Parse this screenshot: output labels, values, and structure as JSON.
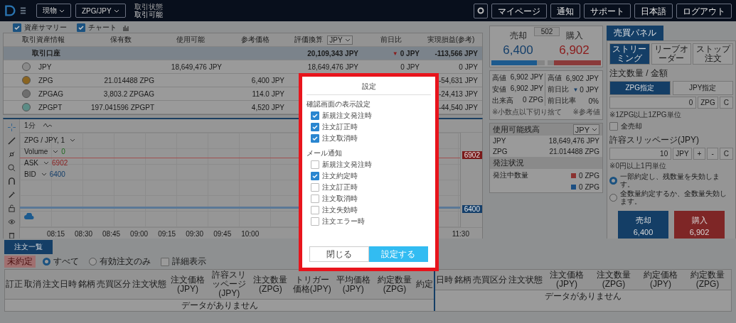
{
  "header": {
    "menu": "現物",
    "pair": "ZPG/JPY",
    "status_label": "取引状態",
    "status": "取引可能",
    "buttons": [
      "マイページ",
      "通知",
      "サポート",
      "日本語",
      "ログアウト"
    ]
  },
  "view_toggles": [
    {
      "label": "資産サマリー",
      "checked": true
    },
    {
      "label": "チャート",
      "checked": true
    }
  ],
  "assets": {
    "columns": [
      "取引資産情報",
      "保有数",
      "使用可能",
      "参考価格",
      "評価換算",
      "前日比",
      "実現損益(参考)"
    ],
    "currency_select": "JPY",
    "rows": [
      {
        "kind": "total",
        "name": "取引口座",
        "value": "20,109,343 JPY",
        "change_mark": "▼",
        "change": "0 JPY",
        "pnl": "-113,566 JPY"
      },
      {
        "kind": "asset",
        "name": "JPY",
        "color": "#8a8a8a",
        "usable": "18,649,476 JPY",
        "value": "18,649,476 JPY",
        "change": "0 JPY",
        "pnl": "0 JPY"
      },
      {
        "kind": "asset",
        "name": "ZPG",
        "color": "#8a6420",
        "held": "21.014488 ZPG",
        "price": "6,400 JPY",
        "pnl": "-54,631 JPY"
      },
      {
        "kind": "asset",
        "name": "ZPGAG",
        "color": "#6e6e6e",
        "held": "3,803.2 ZPGAG",
        "price": "114.0 JPY",
        "pnl": "-24,413 JPY"
      },
      {
        "kind": "asset",
        "name": "ZPGPT",
        "color": "#5c8c86",
        "held": "197.041596 ZPGPT",
        "price": "4,520 JPY",
        "pnl": "-44,540 JPY"
      }
    ]
  },
  "chart": {
    "interval": "1分",
    "symbol": "ZPG / JPY, 1",
    "volume_label": "Volume",
    "volume": "0",
    "ask_label": "ASK",
    "ask": "6902",
    "bid_label": "BID",
    "bid": "6400",
    "ask_tag": "6902",
    "bid_tag": "6400",
    "times": [
      "08:15",
      "08:30",
      "08:45",
      "09:00",
      "09:15",
      "09:30",
      "09:45",
      "10:00"
    ],
    "last_time": "11:30"
  },
  "quote": {
    "sell_label": "売却",
    "spread": "502",
    "buy_label": "購入",
    "bid": "6,400",
    "ask": "6,902"
  },
  "stats_left": [
    {
      "label": "高値",
      "value": "6,902 JPY"
    },
    {
      "label": "安値",
      "value": "6,902 JPY"
    },
    {
      "label": "出来高",
      "value": "0 ZPG"
    }
  ],
  "stats_right": [
    {
      "label": "高値",
      "value": "6,902 JPY"
    },
    {
      "label": "前日比",
      "mark": "▼",
      "value": "0 JPY"
    },
    {
      "label": "前日比率",
      "value": "0%"
    }
  ],
  "stats_notes": [
    "※小数点以下切り捨て",
    "※参考値"
  ],
  "balance": {
    "title": "使用可能残高",
    "currency_select": "JPY",
    "rows": [
      {
        "currency": "JPY",
        "amount": "18,649,476 JPY"
      },
      {
        "currency": "ZPG",
        "amount": "21.014488 ZPG"
      }
    ]
  },
  "order_status": {
    "title": "発注状況",
    "label": "発注中数量",
    "rows": [
      {
        "color": "#8a3230",
        "amount": "0 ZPG"
      },
      {
        "color": "#1c4f82",
        "amount": "0 ZPG"
      }
    ]
  },
  "trade_panel": {
    "tab": "売買パネル",
    "order_types": [
      {
        "label": "ストリーミング",
        "selected": true
      },
      {
        "label": "リーブオーダー",
        "selected": false
      },
      {
        "label": "ストップ注文",
        "selected": false
      }
    ],
    "amount_label": "注文数量 / 金額",
    "modes": [
      {
        "label": "ZPG指定",
        "selected": true
      },
      {
        "label": "JPY指定",
        "selected": false
      }
    ],
    "amount": "0",
    "amount_unit": "ZPG",
    "clear": "C",
    "amount_note": "※1ZPG以上1ZPG単位",
    "sell_all": {
      "label": "全売却",
      "checked": false
    },
    "slippage_label": "許容スリッページ(JPY)",
    "slippage": "10",
    "slippage_unit": "JPY",
    "plus": "+",
    "minus": "-",
    "slippage_clear": "C",
    "slippage_note": "※0円以上1円単位",
    "fill_options": [
      {
        "label": "一部約定し、残数量を失効します。",
        "selected": true
      },
      {
        "label": "全数量約定するか、全数量失効します。",
        "selected": false
      }
    ],
    "sell_button": {
      "label": "売却",
      "price": "6,400"
    },
    "buy_button": {
      "label": "購入",
      "price": "6,902"
    }
  },
  "orders": {
    "button": "注文一覧",
    "tag": "未約定",
    "filters": [
      {
        "label": "すべて",
        "selected": true
      },
      {
        "label": "有効注文のみ",
        "selected": false
      }
    ],
    "detail": {
      "label": "詳細表示",
      "checked": false
    },
    "left_columns": [
      "訂正",
      "取消",
      "注文日時",
      "銘柄",
      "売買区分",
      "注文状態",
      "注文価格(JPY)",
      "許容スリッページ(JPY)",
      "注文数量(ZPG)",
      "トリガー価格(JPY)",
      "平均価格(JPY)",
      "約定数量(ZPG)",
      "約定"
    ],
    "right_columns": [
      "日時",
      "銘柄",
      "売買区分",
      "注文状態",
      "注文価格(JPY)",
      "注文数量(ZPG)",
      "約定価格(JPY)",
      "約定数量(ZPG)"
    ],
    "left_empty": "データがありません",
    "right_empty": "データがありません"
  },
  "modal": {
    "title": "設定",
    "sections": [
      {
        "title": "確認画面の表示設定",
        "options": [
          {
            "label": "新規注文発注時",
            "checked": true
          },
          {
            "label": "注文訂正時",
            "checked": true
          },
          {
            "label": "注文取消時",
            "checked": true
          }
        ]
      },
      {
        "title": "メール通知",
        "options": [
          {
            "label": "新規注文発注時",
            "checked": false
          },
          {
            "label": "注文約定時",
            "checked": true
          },
          {
            "label": "注文訂正時",
            "checked": false
          },
          {
            "label": "注文取消時",
            "checked": false
          },
          {
            "label": "注文失効時",
            "checked": false
          },
          {
            "label": "注文エラー時",
            "checked": false
          }
        ]
      }
    ],
    "buttons": [
      {
        "label": "閉じる",
        "kind": "secondary"
      },
      {
        "label": "設定する",
        "kind": "primary"
      }
    ]
  }
}
